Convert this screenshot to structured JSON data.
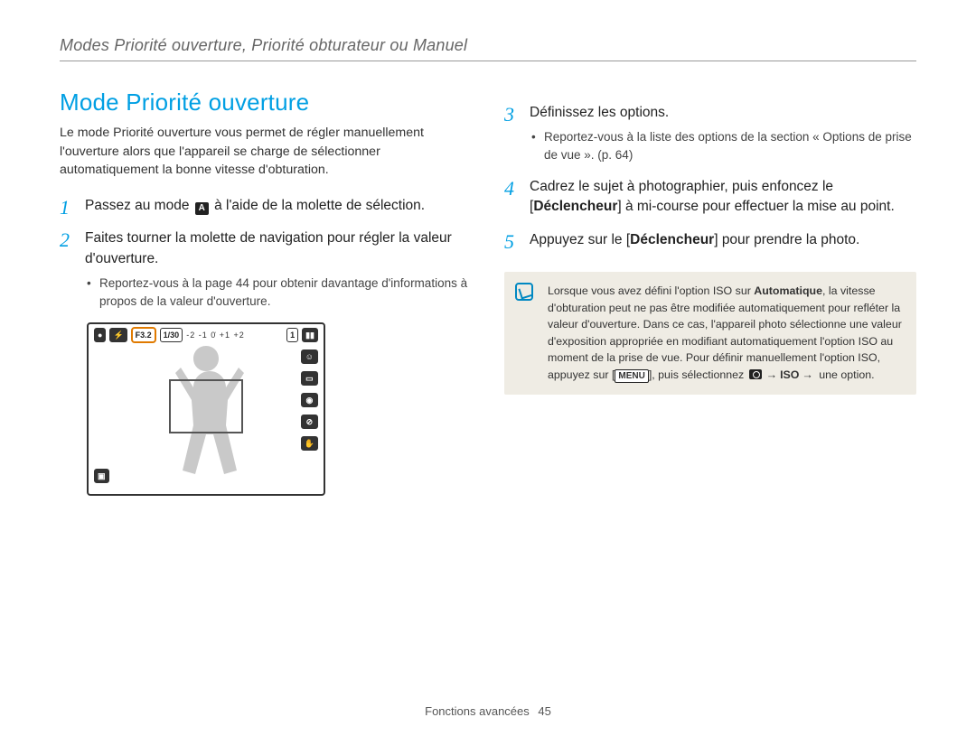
{
  "header": {
    "breadcrumb": "Modes Priorité ouverture, Priorité obturateur ou Manuel"
  },
  "section": {
    "title": "Mode Priorité ouverture",
    "intro": "Le mode Priorité ouverture vous permet de régler manuellement l'ouverture alors que l'appareil se charge de sélectionner automatiquement la bonne vitesse d'obturation."
  },
  "steps_left": {
    "s1_pre": "Passez au mode ",
    "s1_mode_glyph": "A",
    "s1_post": " à l'aide de la molette de sélection.",
    "s2": "Faites tourner la molette de navigation pour régler la valeur d'ouverture.",
    "s2_sub": "Reportez-vous à la page 44 pour obtenir davantage d'informations à propos de la valeur d'ouverture."
  },
  "camera_screen": {
    "aperture": "F3.2",
    "shutter": "1/30",
    "battery": "1",
    "ticks": "-2 -1  0̇  +1 +2"
  },
  "steps_right": {
    "s3": "Définissez les options.",
    "s3_sub": "Reportez-vous à la liste des options de la section « Options de prise de vue ». (p. 64)",
    "s4_pre": "Cadrez le sujet à photographier, puis enfoncez le [",
    "s4_bold": "Déclencheur",
    "s4_post": "] à mi-course pour effectuer la mise au point.",
    "s5_pre": "Appuyez sur le [",
    "s5_bold": "Déclencheur",
    "s5_post": "] pour prendre la photo."
  },
  "note": {
    "pre": "Lorsque vous avez défini l'option ISO sur ",
    "auto": "Automatique",
    "mid": ", la vitesse d'obturation peut ne pas être modifiée automatiquement pour refléter la valeur d'ouverture. Dans ce cas, l'appareil photo sélectionne une valeur d'exposition appropriée en modifiant automatiquement l'option ISO au moment de la prise de vue. Pour définir manuellement l'option ISO, appuyez sur [",
    "menu_label": "MENU",
    "post1": "], puis sélectionnez ",
    "iso": "ISO",
    "post2": " une option."
  },
  "footer": {
    "section": "Fonctions avancées",
    "page": "45"
  }
}
